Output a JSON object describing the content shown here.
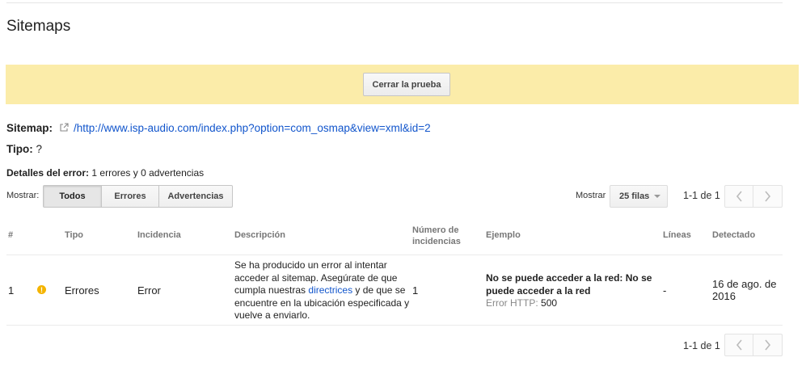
{
  "page": {
    "title": "Sitemaps"
  },
  "banner": {
    "close_button": "Cerrar la prueba"
  },
  "info": {
    "sitemap_label": "Sitemap:",
    "sitemap_url": "/http://www.isp-audio.com/index.php?option=com_osmap&view=xml&id=2",
    "tipo_label": "Tipo:",
    "tipo_value": "?"
  },
  "details": {
    "label": "Detalles del error:",
    "value": "1 errores y 0 advertencias"
  },
  "filters": {
    "show_label": "Mostrar:",
    "buttons": [
      "Todos",
      "Errores",
      "Advertencias"
    ],
    "active": "Todos"
  },
  "rows_selector": {
    "label": "Mostrar",
    "value": "25 filas"
  },
  "pagination": {
    "text": "1-1 de 1"
  },
  "table": {
    "headers": [
      "#",
      "Tipo",
      "Incidencia",
      "Descripción",
      "Número de incidencias",
      "Ejemplo",
      "Líneas",
      "Detectado"
    ],
    "rows": [
      {
        "num": "1",
        "tipo": "Errores",
        "incidencia": "Error",
        "descripcion_before": "Se ha producido un error al intentar acceder al sitemap. Asegúrate de que cumpla nuestras ",
        "descripcion_link": "directrices",
        "descripcion_after": " y de que se encuentre en la ubicación especificada y vuelve a enviarlo.",
        "numero": "1",
        "ejemplo_title": "No se puede acceder a la red: No se puede acceder a la red",
        "ejemplo_label": "Error HTTP:",
        "ejemplo_code": "500",
        "lineas": "-",
        "detectado": "16 de ago. de 2016"
      }
    ]
  },
  "colors": {
    "banner": "#fbeca9",
    "link": "#1155cc",
    "warning": "#f4b400"
  }
}
